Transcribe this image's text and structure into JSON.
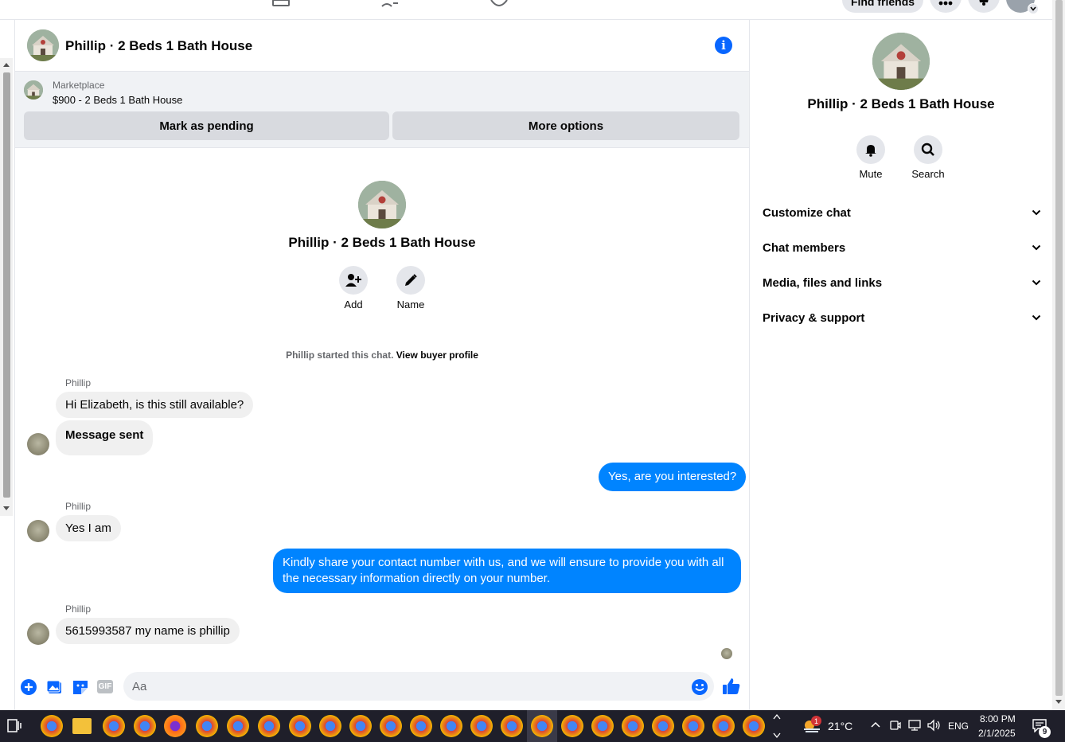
{
  "topbar": {
    "find_friends": "Find friends"
  },
  "header": {
    "title": "Phillip · 2 Beds 1 Bath House"
  },
  "marketplace": {
    "label": "Marketplace",
    "listing": "$900 - 2 Beds 1 Bath House",
    "pending_button": "Mark as pending",
    "more_button": "More options"
  },
  "profile": {
    "name": "Phillip · 2 Beds 1 Bath House",
    "add_label": "Add",
    "name_label": "Name"
  },
  "chat": {
    "started_text": "Phillip started this chat.",
    "view_profile": "View buyer profile",
    "messages": [
      {
        "sender": "Phillip",
        "text": "Hi Elizabeth, is this still available?"
      },
      {
        "text": "Message sent"
      },
      {
        "text": "Yes, are you interested?"
      },
      {
        "sender": "Phillip",
        "text": "Yes I am"
      },
      {
        "text": "Kindly share your contact number with us, and we will ensure to provide you with all the necessary information directly on your number."
      },
      {
        "sender": "Phillip",
        "text": "5615993587 my name is phillip"
      }
    ]
  },
  "composer": {
    "placeholder": "Aa",
    "gif_label": "GIF"
  },
  "sidebar": {
    "name": "Phillip · 2 Beds 1 Bath House",
    "mute": "Mute",
    "search": "Search",
    "sections": [
      "Customize chat",
      "Chat members",
      "Media, files and links",
      "Privacy & support"
    ]
  },
  "taskbar": {
    "temperature": "21°C",
    "language": "ENG",
    "time": "8:00 PM",
    "date": "2/1/2025",
    "notification_count": "9",
    "weather_badge": "1"
  },
  "colors": {
    "accent": "#0866ff",
    "outgoing_bubble": "#0084ff",
    "incoming_bubble": "#f0f0f0"
  }
}
